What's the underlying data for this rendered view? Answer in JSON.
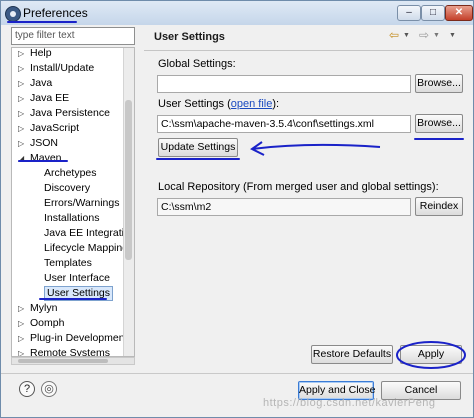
{
  "window": {
    "title": "Preferences",
    "min_icon": "minimize-icon",
    "max_icon": "maximize-icon",
    "close_icon": "close-icon",
    "min_glyph": "–",
    "max_glyph": "□",
    "close_glyph": "✕"
  },
  "filter": {
    "placeholder": "type filter text"
  },
  "tree": {
    "items": [
      {
        "label": "Help",
        "expanded": false,
        "level": 0
      },
      {
        "label": "Install/Update",
        "expanded": false,
        "level": 0
      },
      {
        "label": "Java",
        "expanded": false,
        "level": 0
      },
      {
        "label": "Java EE",
        "expanded": false,
        "level": 0
      },
      {
        "label": "Java Persistence",
        "expanded": false,
        "level": 0
      },
      {
        "label": "JavaScript",
        "expanded": false,
        "level": 0
      },
      {
        "label": "JSON",
        "expanded": false,
        "level": 0
      },
      {
        "label": "Maven",
        "expanded": true,
        "level": 0
      },
      {
        "label": "Archetypes",
        "level": 1
      },
      {
        "label": "Discovery",
        "level": 1
      },
      {
        "label": "Errors/Warnings",
        "level": 1
      },
      {
        "label": "Installations",
        "level": 1
      },
      {
        "label": "Java EE Integration",
        "level": 1
      },
      {
        "label": "Lifecycle Mapping",
        "level": 1
      },
      {
        "label": "Templates",
        "level": 1
      },
      {
        "label": "User Interface",
        "level": 1
      },
      {
        "label": "User Settings",
        "level": 1,
        "selected": true
      },
      {
        "label": "Mylyn",
        "expanded": false,
        "level": 0
      },
      {
        "label": "Oomph",
        "expanded": false,
        "level": 0
      },
      {
        "label": "Plug-in Development",
        "expanded": false,
        "level": 0
      },
      {
        "label": "Remote Systems",
        "expanded": false,
        "level": 0
      }
    ]
  },
  "page": {
    "title": "User Settings",
    "global_label": "Global Settings:",
    "global_value": "",
    "browse_label": "Browse...",
    "user_label_prefix": "User Settings (",
    "user_label_link": "open file",
    "user_label_suffix": "):",
    "user_value": "C:\\ssm\\apache-maven-3.5.4\\conf\\settings.xml",
    "update_label": "Update Settings",
    "local_repo_label": "Local Repository (From merged user and global settings):",
    "local_repo_value": "C:\\ssm\\m2",
    "reindex_label": "Reindex",
    "restore_defaults_label": "Restore Defaults",
    "apply_label": "Apply"
  },
  "footer": {
    "apply_close_label": "Apply and Close",
    "cancel_label": "Cancel",
    "help_glyph": "?",
    "import_export_glyph": "◎",
    "watermark": "https://blog.csdn.net/kavierPeng"
  },
  "colors": {
    "annotation": "#1a22c8",
    "link": "#1a4ac0"
  }
}
